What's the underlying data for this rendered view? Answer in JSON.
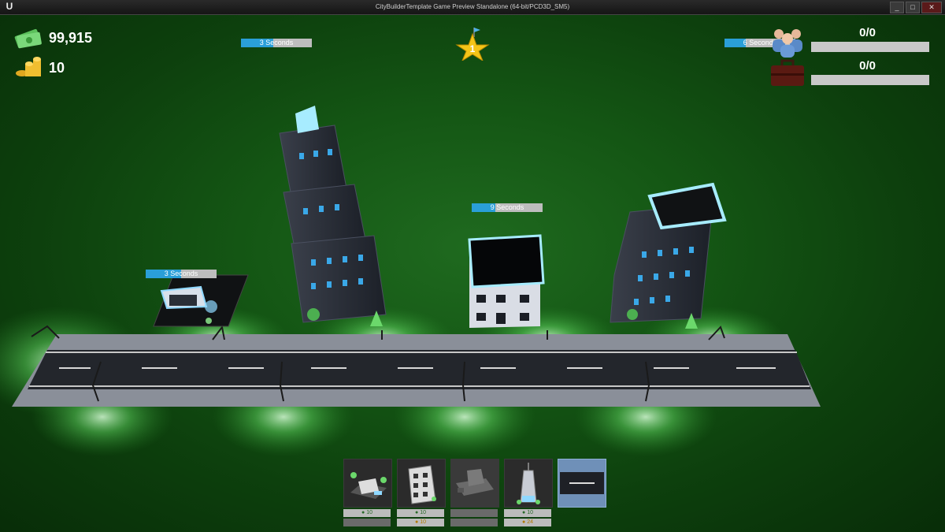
{
  "window": {
    "title": "CityBuilderTemplate Game Preview Standalone (64-bit/PCD3D_SM5)",
    "logo_letter": "U",
    "minimize": "_",
    "maximize": "□",
    "close": "✕"
  },
  "hud": {
    "money": "99,915",
    "gold": "10",
    "level": "1",
    "population": "0/0",
    "jobs": "0/0"
  },
  "timers": [
    {
      "label": "3 Seconds",
      "progress": 0.45
    },
    {
      "label": "6 Seconds",
      "progress": 0.3
    },
    {
      "label": "9 Seconds",
      "progress": 0.33
    },
    {
      "label": "3 Seconds",
      "progress": 0.5
    }
  ],
  "build_menu": [
    {
      "name": "house",
      "cost_primary": "10",
      "cost_secondary": ""
    },
    {
      "name": "apartment",
      "cost_primary": "10",
      "cost_secondary": "10"
    },
    {
      "name": "office",
      "cost_primary": "",
      "cost_secondary": ""
    },
    {
      "name": "skyscraper",
      "cost_primary": "10",
      "cost_secondary": "24"
    },
    {
      "name": "road",
      "cost_primary": "",
      "cost_secondary": ""
    }
  ],
  "colors": {
    "timer_fill": "#2a9fd8",
    "ground": "#145614",
    "building_glow": "#8fd8ff"
  }
}
